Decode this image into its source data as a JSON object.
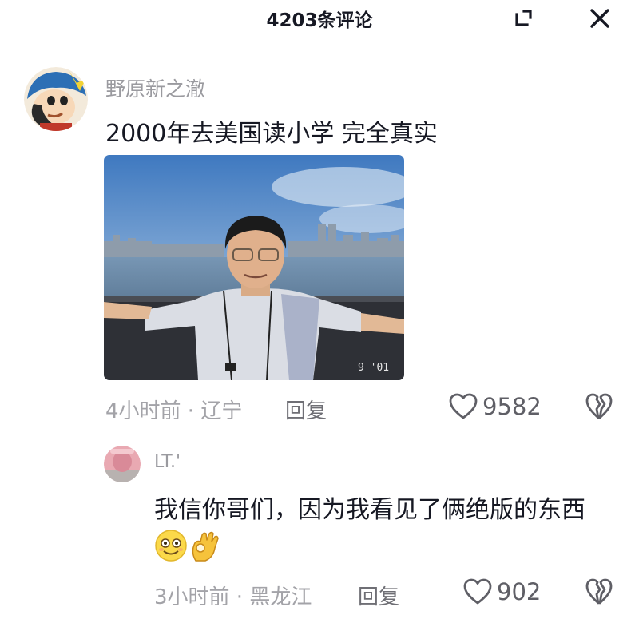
{
  "header": {
    "title": "4203条评论"
  },
  "comments": [
    {
      "username": "野原新之澈",
      "text": "2000年去美国读小学 完全真实",
      "time_location": "4小时前 · 辽宁",
      "reply_label": "回复",
      "likes": "9582"
    },
    {
      "username": "LT.'",
      "text": "我信你哥们，因为我看见了俩绝版的东西",
      "time_location": "3小时前 · 黑龙江",
      "reply_label": "回复",
      "likes": "902"
    }
  ],
  "icons": {
    "expand": "expand-icon",
    "close": "close-icon",
    "like": "heart-outline-icon",
    "dislike": "broken-heart-icon",
    "emoji_1": "smiling-face-emoji",
    "emoji_2": "ok-hand-emoji"
  },
  "colors": {
    "text": "#161823",
    "secondary": "#9a9a9f",
    "icon": "#5f5f66"
  }
}
